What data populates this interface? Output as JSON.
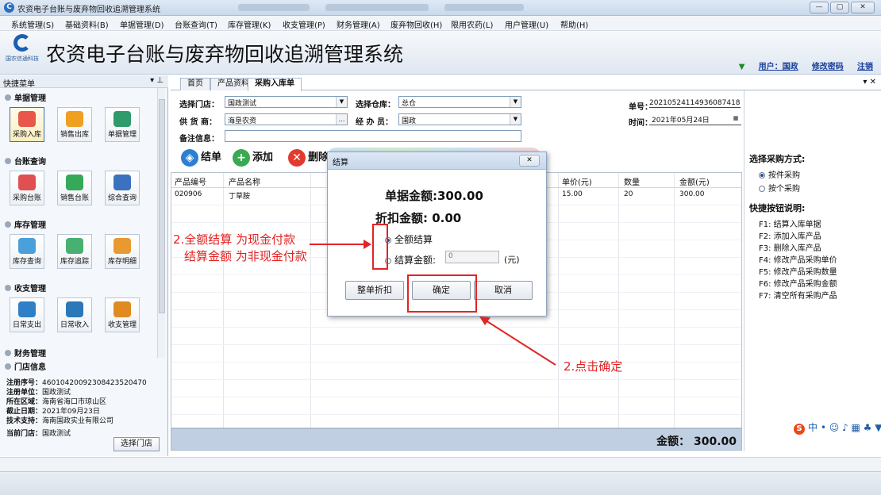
{
  "window": {
    "title": "农资电子台账与废弃物回收追溯管理系统",
    "controls": [
      "—",
      "▢",
      "✕"
    ]
  },
  "menu": [
    "系统管理(S)",
    "基础资料(B)",
    "单据管理(D)",
    "台账查询(T)",
    "库存管理(K)",
    "收支管理(P)",
    "财务管理(A)",
    "废弃物回收(H)",
    "限用农药(L)",
    "用户管理(U)",
    "帮助(H)"
  ],
  "header": {
    "logo_text": "国农信通科技",
    "system_title": "农资电子台账与废弃物回收追溯管理系统",
    "user_link": "用户：国政",
    "change_password": "修改密码",
    "logout": "注销"
  },
  "left_panel": {
    "header": "快捷菜单",
    "groups": {
      "danju": "单据管理",
      "taizhang": "台账查询",
      "kucun": "库存管理",
      "shouzhi": "收支管理",
      "caiwu": "财务管理",
      "mendian": "门店信息"
    },
    "tiles": {
      "caigou": "采购入库",
      "xiaoshou": "销售出库",
      "danjuguanli": "单据管理",
      "caigoutaizhang": "采购台账",
      "xiaoshoutaizhang": "销售台账",
      "zonghe": "综合查询",
      "kucunchaxun": "库存查询",
      "kucunzhuizong": "库存追踪",
      "kucunmingxi": "库存明细",
      "richangzhichu": "日常支出",
      "richangshouru": "日常收入",
      "shouzhiguanli": "收支管理"
    },
    "store_info": {
      "reg_no_label": "注册序号：",
      "reg_no": "46010420092308423520470",
      "reg_unit_label": "注册单位：",
      "reg_unit": "国政测试",
      "region_label": "所在区域：",
      "region": "海南省海口市琼山区",
      "expiry_label": "截止日期：",
      "expiry": "2021年09月23日",
      "support_label": "技术支持：",
      "support": "海南国政实业有限公司",
      "current_label": "当前门店：",
      "current": "国政测试"
    },
    "select_store_button": "选择门店"
  },
  "tabs": [
    "首页",
    "产品资料",
    "采购入库单"
  ],
  "tab_controls": "▾ ✕",
  "form": {
    "store_label": "选择门店：",
    "store_value": "国政测试",
    "warehouse_label": "选择仓库：",
    "warehouse_value": "总仓",
    "supplier_label": "供 货 商：",
    "supplier_value": "海垦农资",
    "handler_label": "经 办 员：",
    "handler_value": "国政",
    "remark_label": "备注信息：",
    "remark_value": "",
    "order_no_label": "单号：",
    "order_no": "20210524114936087418",
    "time_label": "时间：",
    "time": "2021年05月24日"
  },
  "toolbar": {
    "settle": "结单",
    "add": "添加",
    "delete": "删除"
  },
  "grid": {
    "headers": [
      "产品编号",
      "产品名称",
      "单价(元)",
      "数量",
      "金额(元)"
    ],
    "rows": [
      {
        "code": "020906",
        "name": "丁草胺",
        "price": "15.00",
        "qty": "20",
        "amount": "300.00"
      }
    ]
  },
  "total": {
    "label": "金额：",
    "value": "300.00"
  },
  "right_panel": {
    "purchase_mode_title": "选择采购方式:",
    "mode_by_piece": "按件采购",
    "mode_by_unit": "按个采购",
    "shortcut_title": "快捷按钮说明:",
    "shortcuts": [
      "F1: 结算入库单据",
      "F2: 添加入库产品",
      "F3: 删除入库产品",
      "F4: 修改产品采购单价",
      "F5: 修改产品采购数量",
      "F6: 修改产品采购金额",
      "F7: 清空所有采购产品"
    ]
  },
  "dialog": {
    "title": "结算",
    "doc_amount": "单据金额:300.00",
    "discount_amount": "折扣金额: 0.00",
    "option_full": "全额结算",
    "option_partial": "结算金额:",
    "partial_value": "0",
    "unit": "(元)",
    "btn_discount": "整单折扣",
    "btn_ok": "确定",
    "btn_cancel": "取消"
  },
  "annotations": {
    "note_line1": "2.全额结算 为现金付款",
    "note_line2": "结算金额 为非现金付款",
    "click_ok": "2.点击确定"
  },
  "colors": {
    "annotation_red": "#e12424",
    "link_blue": "#1a3f9b",
    "total_bar": "#c1cfe2"
  }
}
